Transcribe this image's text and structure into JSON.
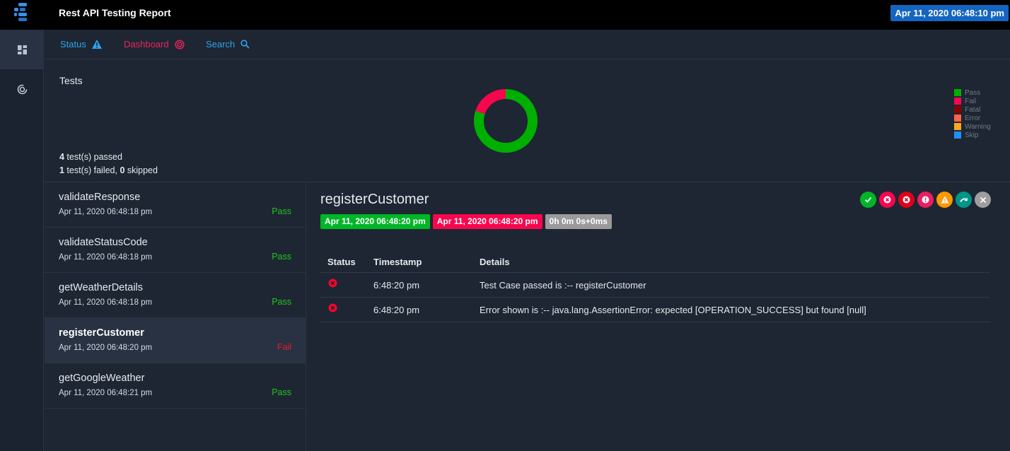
{
  "app": {
    "title": "Rest API Testing Report",
    "date": "Apr 11, 2020 06:48:10 pm"
  },
  "nav": {
    "status_label": "Status",
    "dashboard_label": "Dashboard",
    "search_label": "Search"
  },
  "tests_summary": {
    "title": "Tests",
    "passed_count": "4",
    "passed_text": " test(s) passed",
    "failed_count": "1",
    "failed_text": " test(s) failed, ",
    "skipped_count": "0",
    "skipped_text": " skipped"
  },
  "chart_data": {
    "type": "pie",
    "style": "donut",
    "categories": [
      "Pass",
      "Fail",
      "Fatal",
      "Error",
      "Warning",
      "Skip"
    ],
    "values": [
      4,
      1,
      0,
      0,
      0,
      0
    ],
    "colors": [
      "#00af00",
      "#f7064e",
      "#8b0000",
      "#ff6347",
      "#ffa81c",
      "#1e90ff"
    ],
    "legend_position": "right"
  },
  "test_list": [
    {
      "name": "validateResponse",
      "time": "Apr 11, 2020 06:48:18 pm",
      "status": "Pass"
    },
    {
      "name": "validateStatusCode",
      "time": "Apr 11, 2020 06:48:18 pm",
      "status": "Pass"
    },
    {
      "name": "getWeatherDetails",
      "time": "Apr 11, 2020 06:48:18 pm",
      "status": "Pass"
    },
    {
      "name": "registerCustomer",
      "time": "Apr 11, 2020 06:48:20 pm",
      "status": "Fail"
    },
    {
      "name": "getGoogleWeather",
      "time": "Apr 11, 2020 06:48:21 pm",
      "status": "Pass"
    }
  ],
  "detail": {
    "title": "registerCustomer",
    "start_time": "Apr 11, 2020 06:48:20 pm",
    "end_time": "Apr 11, 2020 06:48:20 pm",
    "duration": "0h 0m 0s+0ms",
    "table_headers": [
      "Status",
      "Timestamp",
      "Details"
    ],
    "logs": [
      {
        "status_icon": "fail-circle-icon",
        "timestamp": "6:48:20 pm",
        "details": "Test Case passed is :-- registerCustomer"
      },
      {
        "status_icon": "fail-circle-icon",
        "timestamp": "6:48:20 pm",
        "details": "Error shown is :-- java.lang.AssertionError: expected [OPERATION_SUCCESS] but found [null]"
      }
    ]
  },
  "filter_buttons": [
    "pass-filter-icon",
    "fail-filter-icon",
    "fatal-filter-icon",
    "error-filter-icon",
    "warning-filter-icon",
    "skip-filter-icon",
    "clear-filter-icon"
  ]
}
